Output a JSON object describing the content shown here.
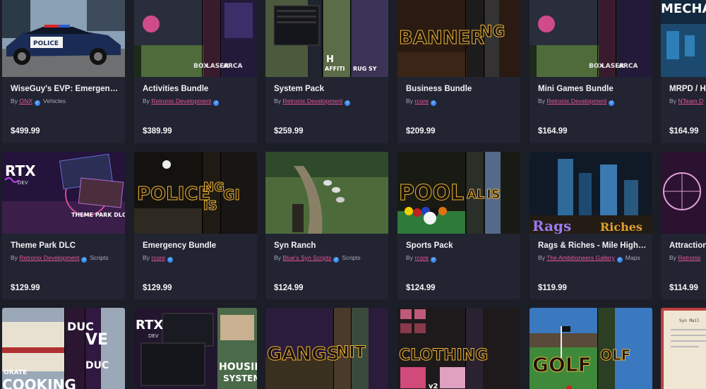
{
  "rows": [
    [
      {
        "title": "WiseGuy's EVP: Emergency...",
        "author": "ONX",
        "category": "Vehicles",
        "price": "$499.99",
        "art": "police-car"
      },
      {
        "title": "Activities Bundle",
        "author": "Retronix Development",
        "category": "",
        "price": "$389.99",
        "art": "activities"
      },
      {
        "title": "System Pack",
        "author": "Retronix Development",
        "category": "",
        "price": "$259.99",
        "art": "system"
      },
      {
        "title": "Business Bundle",
        "author": "rcore",
        "category": "",
        "price": "$209.99",
        "art": "business"
      },
      {
        "title": "Mini Games Bundle",
        "author": "Retronix Development",
        "category": "",
        "price": "$164.99",
        "art": "minigames"
      },
      {
        "title": "MRPD / H",
        "author": "NTeam D",
        "category": "",
        "price": "$164.99",
        "art": "mrpd"
      }
    ],
    [
      {
        "title": "Theme Park DLC",
        "author": "Retronix Development",
        "category": "Scripts",
        "price": "$129.99",
        "art": "themepark"
      },
      {
        "title": "Emergency Bundle",
        "author": "rcore",
        "category": "",
        "price": "$129.99",
        "art": "emergency"
      },
      {
        "title": "Syn Ranch",
        "author": "Blue's Syn Scripts",
        "category": "Scripts",
        "price": "$124.99",
        "art": "ranch"
      },
      {
        "title": "Sports Pack",
        "author": "rcore",
        "category": "",
        "price": "$124.99",
        "art": "sports"
      },
      {
        "title": "Rags & Riches - Mile High ...",
        "author": "The Ambitioneers Gallery",
        "category": "Maps",
        "price": "$119.99",
        "art": "rags"
      },
      {
        "title": "Attraction",
        "author": "Retronix",
        "category": "",
        "price": "$114.99",
        "art": "attraction"
      }
    ],
    [
      {
        "title": "",
        "author": "",
        "category": "",
        "price": "",
        "art": "cooking"
      },
      {
        "title": "",
        "author": "",
        "category": "",
        "price": "",
        "art": "housing"
      },
      {
        "title": "",
        "author": "",
        "category": "",
        "price": "",
        "art": "gangs"
      },
      {
        "title": "",
        "author": "",
        "category": "",
        "price": "",
        "art": "clothing"
      },
      {
        "title": "",
        "author": "",
        "category": "",
        "price": "",
        "art": "golf"
      },
      {
        "title": "",
        "author": "",
        "category": "",
        "price": "",
        "art": "mail"
      }
    ]
  ],
  "art_text": {
    "police_car_label": "POLICE",
    "activities": [
      "BOX",
      "LASER",
      "ARCA"
    ],
    "system": [
      "H",
      "AFFITI",
      "RUG SY"
    ],
    "business": [
      "BANNER",
      "NG"
    ],
    "mrpd": "MECHA",
    "themepark_rtx": "RTX",
    "themepark_dev": "DEV",
    "themepark_label": "THEME PARK DLC",
    "emergency": [
      "POLICE",
      "NG",
      "IS",
      "GI"
    ],
    "sports": [
      "POOL",
      "AL",
      "IS"
    ],
    "rags": [
      "Rags",
      "Riches"
    ],
    "cooking": [
      "ORATE",
      "COOKING",
      "DUC",
      "VE",
      "DUC"
    ],
    "housing": [
      "RTX",
      "DEV",
      "HOUSING",
      "SYSTEM"
    ],
    "gangs": [
      "GANGS",
      "NIT"
    ],
    "clothing": [
      "CLOTHING",
      "v2"
    ],
    "golf": [
      "GOLF",
      "OLF"
    ],
    "mail": "Syn Mail"
  }
}
